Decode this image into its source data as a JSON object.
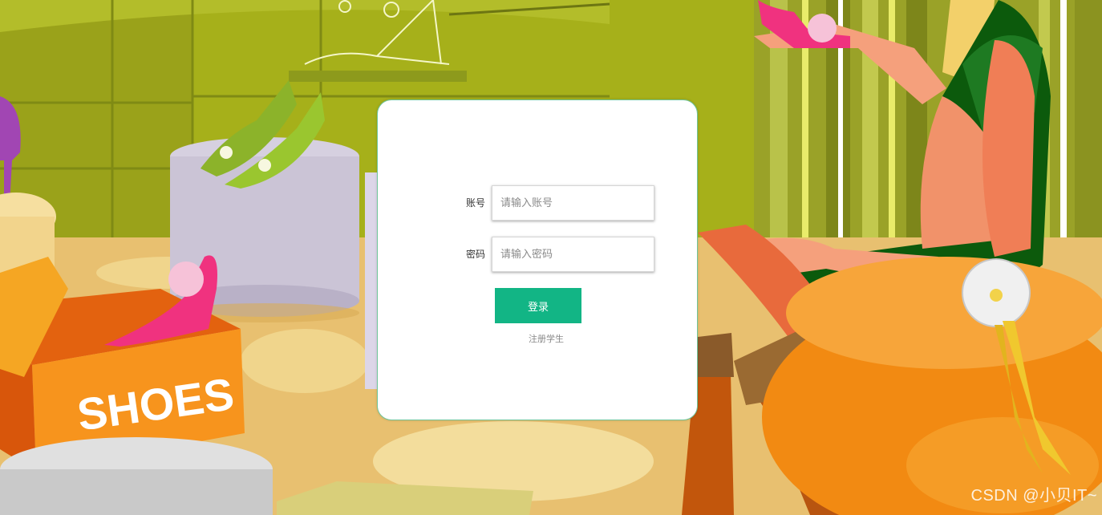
{
  "login": {
    "account_label": "账号",
    "account_placeholder": "请输入账号",
    "account_value": "",
    "password_label": "密码",
    "password_placeholder": "请输入密码",
    "password_value": "",
    "login_button": "登录",
    "register_link": "注册学生"
  },
  "background": {
    "box_text": "SHOES",
    "watermark": "CSDN @小贝IT~"
  },
  "colors": {
    "accent": "#12b585",
    "card_border": "#6fc59a",
    "wall": "#a8b21a",
    "box_orange": "#f7941d",
    "dress_green": "#0c5a0c",
    "shoe_pink": "#f0327f"
  }
}
